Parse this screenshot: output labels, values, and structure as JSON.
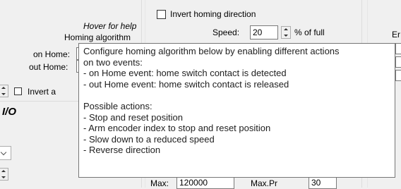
{
  "left_panel": {
    "hover_hint": "Hover for help",
    "homing_algorithm_label": "Homing algorithm",
    "on_home_label": "on Home:",
    "out_home_label": "out Home:",
    "invert_label": "Invert a",
    "section_title": "I/O"
  },
  "middle_panel": {
    "invert_homing_label": "Invert homing direction",
    "speed_label": "Speed:",
    "speed_value": "20",
    "speed_unit": "% of full",
    "max_label": "Max:",
    "max_value": "120000",
    "max2_label": "Max.Pr",
    "max2_value": "30"
  },
  "right_panel": {
    "label_fragment": "Er"
  },
  "tooltip": {
    "lines": [
      "Configure homing algorithm below by enabling different actions",
      "on two events:",
      "- on Home event: home switch contact is detected",
      "- out Home event: home switch contact is released",
      "",
      "Possible actions:",
      "- Stop and reset position",
      "- Arm encoder index to stop and reset position",
      "- Slow down to a reduced speed",
      "- Reverse direction"
    ]
  }
}
